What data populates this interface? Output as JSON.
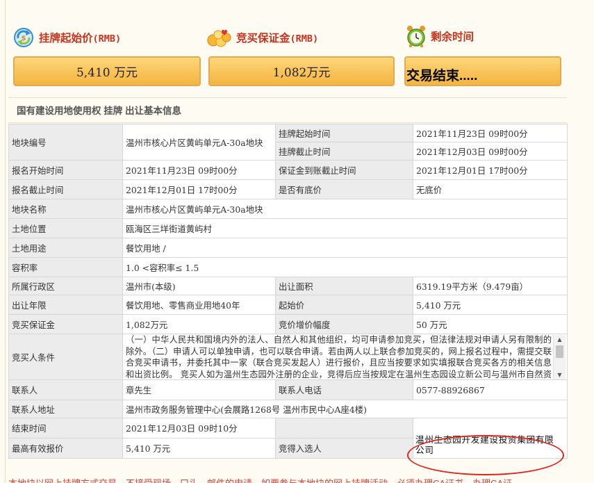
{
  "colors": {
    "label_red": "#c8321d",
    "tile_fill": "#f8c358",
    "tile_border": "#e2a94d",
    "label_cell_bg": "#ececec",
    "highlight_oval": "#e3231b"
  },
  "tiles": [
    {
      "icon": "money-refresh-icon",
      "label": "挂牌起始价",
      "unit": "(RMB)",
      "value": "5,410 万元"
    },
    {
      "icon": "coins-heart-icon",
      "label": "竞买保证金",
      "unit": "(RMB)",
      "value": "1,082万元"
    },
    {
      "icon": "alarm-clock-icon",
      "label": "剩余时间",
      "unit": "",
      "value": "交易结束....."
    }
  ],
  "section": {
    "title": "国有建设用地使用权 挂牌 出让基本信息"
  },
  "table": {
    "parcel_no_label": "地块编号",
    "parcel_no": "温州市核心片区黄屿单元A-30a地块",
    "listing_start_label": "挂牌起始时间",
    "listing_start": "2021年11月23日 09时00分",
    "listing_end_label": "挂牌截止时间",
    "listing_end": "2021年12月03日 09时00分",
    "signup_start_label": "报名开始时间",
    "signup_start": "2021年11月23日 09时00分",
    "deposit_deadline_label": "保证金到账截止时间",
    "deposit_deadline": "2021年12月01日 17时00分",
    "signup_end_label": "报名截止时间",
    "signup_end": "2021年12月01日 17时00分",
    "reserve_label": "是否有底价",
    "reserve": "无底价",
    "parcel_name_label": "地块名称",
    "parcel_name": "温州市核心片区黄屿单元A-30a地块",
    "location_label": "土地位置",
    "location": "瓯海区三垟街道黄屿村",
    "usage_label": "土地用途",
    "usage": "餐饮用地 /",
    "far_label": "容积率",
    "far": "1.0 <容积率≤ 1.5",
    "district_label": "所属行政区",
    "district": "温州市(本级)",
    "area_label": "出让面积",
    "area": "6319.19平方米（9.479亩）",
    "term_label": "出让年限",
    "term": "餐饮用地、零售商业用地40年",
    "start_price_label": "起始价",
    "start_price": "5,410 万元",
    "bid_deposit_label": "竞买保证金",
    "bid_deposit": "1,082万元",
    "increment_label": "竞价增价幅度",
    "increment": "50 万元",
    "conditions_label": "竞买人条件",
    "conditions": "（一）中华人民共和国境内外的法人、自然人和其他组织，均可申请参加竞买，但法律法规对申请人另有限制的除外。（二）申请人可以单独申请，也可以联合申请。若由两人以上联合参加竞买的，网上报名过程中，需提交联合竞买申请书，并委托其中一家（联合竞买发起人）进行报价，且应当按要求如实填报联合竞买各方的相关信息和出资比例。 竞买人如为温州生态园外注册的企业，竞得后应当按规定在温州生态园设立新公司与温州市自然资源和规划局签订《国有建设用地使用权出让合同》，对竞得地块进行开",
    "contact_label": "联系人",
    "contact": "章先生",
    "phone_label": "联系人电话",
    "phone": "0577-88926867",
    "address_label": "联系人地址",
    "address": "温州市政务服务管理中心(会展路1268号 温州市民中心A座4楼)",
    "end_time_label": "结束时间",
    "end_time": "2021年12月03日 09时10分",
    "top_bid_label": "最高有效报价",
    "top_bid": "5,410 万元",
    "winner_label": "竞得入选人",
    "winner": "温州生态园开发建设投资集团有限公司"
  },
  "footer": {
    "notice": "本地块以网上挂牌方式交易，不接受现场、口头、邮件的申请，如要参与本地块的网上挂牌活动，必须办理CA证书，办理CA证"
  }
}
